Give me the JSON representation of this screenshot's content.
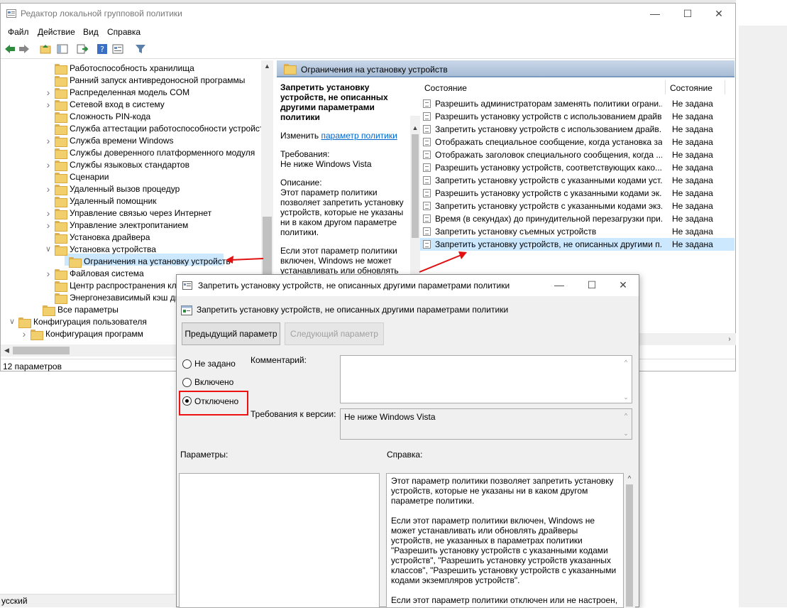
{
  "window": {
    "title": "Редактор локальной групповой политики",
    "menu": [
      "Файл",
      "Действие",
      "Вид",
      "Справка"
    ],
    "status": "12 параметров",
    "language": "усский"
  },
  "tree": {
    "items": [
      {
        "label": "Работоспособность хранилища",
        "chev": ""
      },
      {
        "label": "Ранний запуск антивредоносной программы",
        "chev": ""
      },
      {
        "label": "Распределенная модель COM",
        "chev": ">"
      },
      {
        "label": "Сетевой вход в систему",
        "chev": ">"
      },
      {
        "label": "Сложность PIN-кода",
        "chev": ""
      },
      {
        "label": "Служба аттестации работоспособности устройств",
        "chev": ""
      },
      {
        "label": "Служба времени Windows",
        "chev": ">"
      },
      {
        "label": "Службы доверенного платформенного модуля",
        "chev": ""
      },
      {
        "label": "Службы языковых стандартов",
        "chev": ">"
      },
      {
        "label": "Сценарии",
        "chev": ""
      },
      {
        "label": "Удаленный вызов процедур",
        "chev": ">"
      },
      {
        "label": "Удаленный помощник",
        "chev": ""
      },
      {
        "label": "Управление связью через Интернет",
        "chev": ">"
      },
      {
        "label": "Управление электропитанием",
        "chev": ">"
      },
      {
        "label": "Установка драйвера",
        "chev": ""
      },
      {
        "label": "Установка устройства",
        "chev": "v"
      },
      {
        "label": "Ограничения на установку устройств",
        "chev": ""
      },
      {
        "label": "Файловая система",
        "chev": ">"
      },
      {
        "label": "Центр распространения клю",
        "chev": ""
      },
      {
        "label": "Энергонезависимый кэш дис",
        "chev": ""
      },
      {
        "label": "Все параметры",
        "chev": ""
      },
      {
        "label": "Конфигурация пользователя",
        "chev": "v"
      },
      {
        "label": "Конфигурация программ",
        "chev": ">"
      }
    ]
  },
  "right_pane": {
    "header": "Ограничения на установку устройств",
    "desc_title": "Запретить установку устройств, не описанных другими параметрами политики",
    "edit_prefix": "Изменить",
    "edit_link": "параметр политики",
    "req_label": "Требования:",
    "req_value": "Не ниже Windows Vista",
    "desc_label": "Описание:",
    "desc_text": "Этот параметр политики позволяет запретить установку устройств, которые не указаны ни в каком другом параметре политики.",
    "desc_text2": "Если этот параметр политики включен, Windows не может устанавливать или обновлять",
    "col_name": "Состояние",
    "col_state": "Состояние",
    "rows": [
      {
        "name": "Разрешить администраторам заменять политики ограни...",
        "state": "Не задана"
      },
      {
        "name": "Разрешить установку устройств с использованием драйв...",
        "state": "Не задана"
      },
      {
        "name": "Запретить установку устройств с использованием драйв...",
        "state": "Не задана"
      },
      {
        "name": "Отображать специальное сообщение, когда установка за...",
        "state": "Не задана"
      },
      {
        "name": "Отображать заголовок специального сообщения, когда ...",
        "state": "Не задана"
      },
      {
        "name": "Разрешить установку устройств, соответствующих како...",
        "state": "Не задана"
      },
      {
        "name": "Запретить установку устройств с указанными кодами уст...",
        "state": "Не задана"
      },
      {
        "name": "Разрешить установку устройств с указанными кодами эк...",
        "state": "Не задана"
      },
      {
        "name": "Запретить установку устройств с указанными кодами экз...",
        "state": "Не задана"
      },
      {
        "name": "Время (в секундах) до принудительной перезагрузки при...",
        "state": "Не задана"
      },
      {
        "name": "Запретить установку съемных устройств",
        "state": "Не задана"
      },
      {
        "name": "Запретить установку устройств, не описанных другими п...",
        "state": "Не задана"
      }
    ]
  },
  "dialog": {
    "title": "Запретить установку устройств, не описанных другими параметрами политики",
    "subtitle": "Запретить установку устройств, не описанных другими параметрами политики",
    "prev_button": "Предыдущий параметр",
    "next_button": "Следующий параметр",
    "radio_not_set": "Не задано",
    "radio_enabled": "Включено",
    "radio_disabled": "Отключено",
    "selected": "Отключено",
    "comment_label": "Комментарий:",
    "version_label": "Требования к версии:",
    "version_value": "Не ниже Windows Vista",
    "params_label": "Параметры:",
    "help_label": "Справка:",
    "help_p1": "Этот параметр политики позволяет запретить установку устройств, которые не указаны ни в каком другом параметре политики.",
    "help_p2": "Если этот параметр политики включен, Windows не может устанавливать или обновлять драйверы устройств, не указанных в параметрах политики \"Разрешить установку устройств с указанными кодами устройств\", \"Разрешить установку устройств указанных классов\", \"Разрешить установку устройств с указанными кодами экземпляров устройств\".",
    "help_p3": "Если этот параметр политики отключен или не настроен,"
  },
  "colors": {
    "highlight": "#cce8ff",
    "header": "#b8cbe2",
    "annotation": "#e11111",
    "link": "#0066cc"
  }
}
